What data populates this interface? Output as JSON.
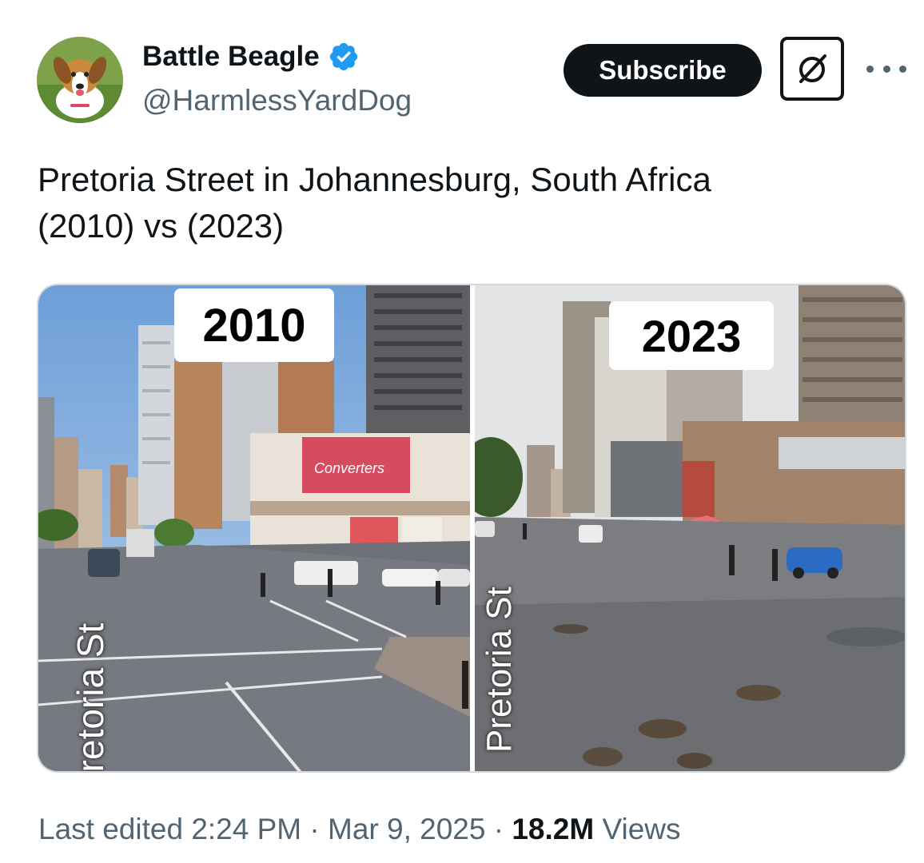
{
  "author": {
    "display_name": "Battle Beagle",
    "handle": "@HarmlessYardDog",
    "verified": true,
    "avatar_icon": "beagle-avatar"
  },
  "actions": {
    "subscribe_label": "Subscribe",
    "grok_icon": "grok-icon",
    "more_icon": "more-icon"
  },
  "tweet": {
    "text": "Pretoria Street in Johannesburg, South Africa\n(2010) vs (2023)"
  },
  "media": {
    "left": {
      "year": "2010",
      "street_label": "Pretoria St"
    },
    "right": {
      "year": "2023",
      "street_label": "Pretoria St"
    }
  },
  "footer": {
    "prefix": "Last edited ",
    "time": "2:24 PM",
    "sep1": " · ",
    "date": "Mar 9, 2025",
    "sep2": " · ",
    "views_count": "18.2M",
    "views_label": " Views"
  },
  "colors": {
    "verified_blue": "#1d9bf0",
    "text_primary": "#0f1419",
    "text_secondary": "#536471"
  }
}
